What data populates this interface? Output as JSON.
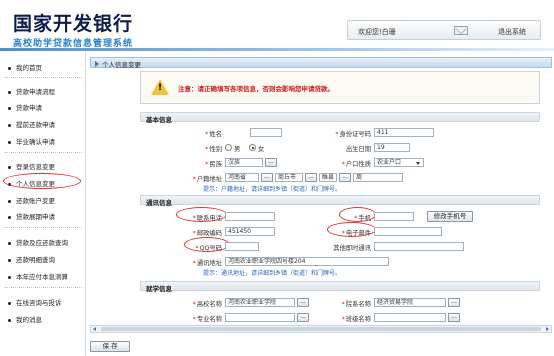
{
  "header": {
    "brand_title": "国家开发银行",
    "brand_subtitle": "高校助学贷款信息管理系统",
    "welcome": "欢迎您!白珊",
    "logout": "退出系统"
  },
  "sidebar": {
    "items": [
      {
        "label": "我的首页"
      },
      {
        "label": "贷款申请流程"
      },
      {
        "label": "贷款申请"
      },
      {
        "label": "提前还款申请"
      },
      {
        "label": "毕业确认申请"
      },
      {
        "label": "登录信息变更"
      },
      {
        "label": "个人信息变更",
        "active": true
      },
      {
        "label": "还款账户变更"
      },
      {
        "label": "贷款展期申请"
      },
      {
        "label": "贷款及应还款查询"
      },
      {
        "label": "还款明细查询"
      },
      {
        "label": "本年应付本息测算"
      },
      {
        "label": "在线咨询与投诉"
      },
      {
        "label": "我的消息"
      }
    ]
  },
  "breadcrumb": "个人信息变更",
  "notice": "注意：请正确填写各项信息，否则会影响您申请贷款。",
  "basic": {
    "title": "基本信息",
    "name_label": "姓名",
    "idno_label": "身份证号码",
    "idno_value": "411",
    "gender_label": "性别",
    "male": "男",
    "female": "女",
    "birth_label": "出生日期",
    "birth_value": "19",
    "nation_label": "民族",
    "nation_value": "汉族",
    "hukou_type_label": "户口性质",
    "hukou_type_value": "农业户口",
    "hukou_addr_label": "户籍地址",
    "province": "河南省",
    "city": "商丘市",
    "county": "睢县",
    "street": "周",
    "tip": "提示：户籍地址，请详细到乡镇（街道）和门牌号。"
  },
  "contact": {
    "title": "通讯信息",
    "phone_label": "联系电话",
    "mobile_label": "手机",
    "change_mobile_btn": "修改手机号",
    "zip_label": "邮政编码",
    "zip_value": "451450",
    "email_label": "电子邮件",
    "qq_label": "QQ号码",
    "other_label": "其他即时通讯",
    "addr_label": "通讯地址",
    "addr_value": "河南农业职业学院四号楼204",
    "tip": "提示：通讯地址，请详细到乡镇（街道）和门牌号。"
  },
  "school": {
    "title": "就学信息",
    "college_label": "高校名称",
    "college_value": "河南农业职业学院",
    "dept_label": "院系名称",
    "dept_value": "经济贸易学院",
    "major_label": "专业名称",
    "class_label": "班级名称"
  },
  "actions": {
    "save": "保 存",
    "dots": "..."
  },
  "colors": {
    "brand": "#0d1c4c",
    "subtitle": "#2a82c8",
    "warning_text": "#d21d1d",
    "tip_link": "#2a66c2",
    "annotation_red": "#e53030"
  }
}
